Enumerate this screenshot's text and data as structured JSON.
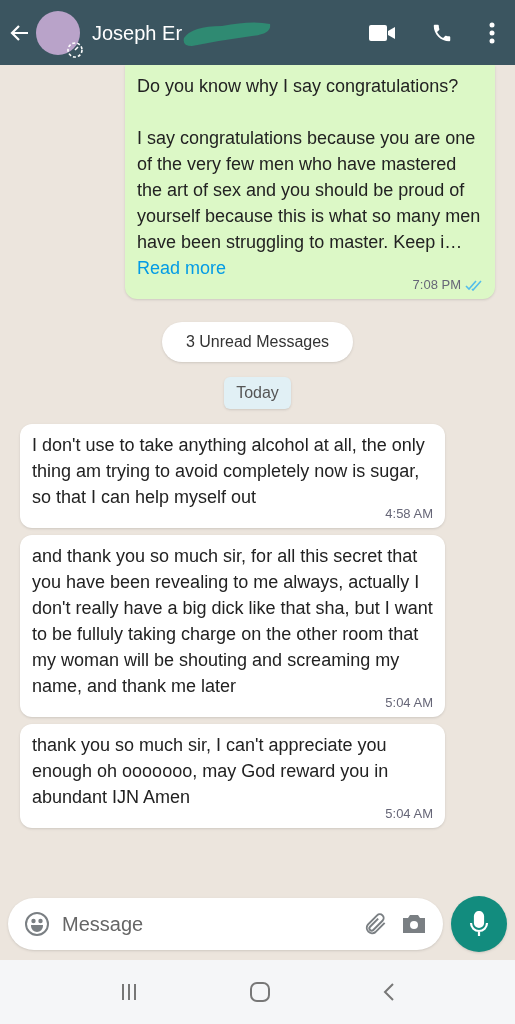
{
  "header": {
    "contact_name": "Joseph Er",
    "name_redacted": true
  },
  "messages": [
    {
      "kind": "outgoing",
      "paragraphs": [
        "Do you know why I say congratulations?",
        "I say congratulations because you are one of the very few men who have mastered the art of sex and you should be proud of yourself because this is what so many men have been struggling to master. Keep i…"
      ],
      "read_more": "Read more",
      "time": "7:08 PM",
      "read": true
    },
    {
      "kind": "unread_banner",
      "text": "3 Unread Messages"
    },
    {
      "kind": "date",
      "text": "Today"
    },
    {
      "kind": "incoming",
      "paragraphs": [
        "I don't use to take anything  alcohol at all,  the only thing am trying to  avoid completely now is sugar,  so that I can help myself out"
      ],
      "time": "4:58 AM"
    },
    {
      "kind": "incoming",
      "paragraphs": [
        "and  thank you so much sir,  for all this secret that you have been revealing to me always,  actually I don't really have a big dick like that sha, but I want to be fulluly taking  charge on the other room  that my woman will be shouting  and screaming my name,  and  thank me later"
      ],
      "time": "5:04 AM"
    },
    {
      "kind": "incoming",
      "paragraphs": [
        "thank you so much sir,  I can't  appreciate you enough oh ooooooo,  may God reward you in abundant IJN Amen"
      ],
      "time": "5:04 AM"
    }
  ],
  "composer": {
    "placeholder": "Message"
  }
}
